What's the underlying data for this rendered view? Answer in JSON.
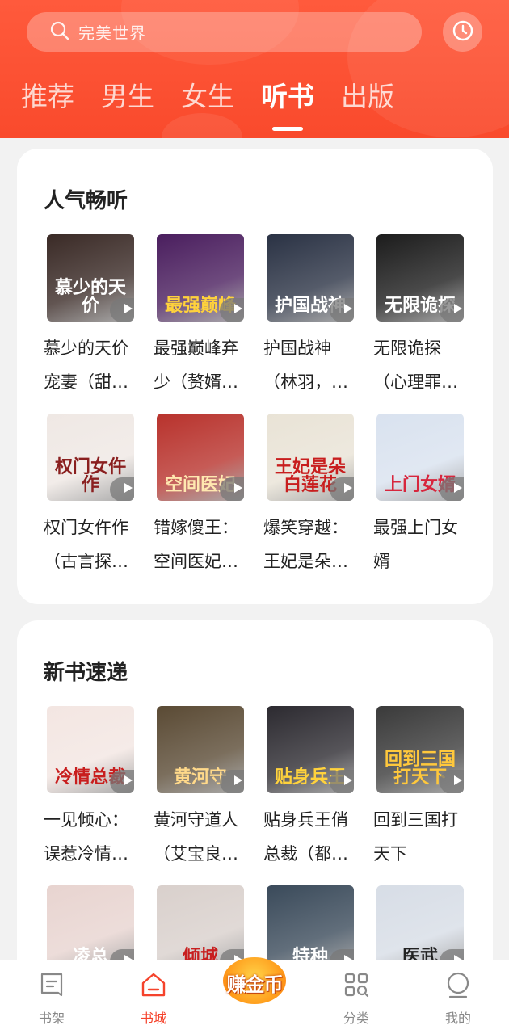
{
  "search": {
    "placeholder": "完美世界"
  },
  "tabs": [
    {
      "label": "推荐",
      "active": false
    },
    {
      "label": "男生",
      "active": false
    },
    {
      "label": "女生",
      "active": false
    },
    {
      "label": "听书",
      "active": true
    },
    {
      "label": "出版",
      "active": false
    }
  ],
  "popular": {
    "title": "人气畅听",
    "books": [
      {
        "name": "慕少的天价宠妻（甜…",
        "cover_text": "慕少的天价",
        "bg": "#3a2a26",
        "fg": "#ffffff"
      },
      {
        "name": "最强巅峰弃少（赘婿…",
        "cover_text": "最强巅峰",
        "bg": "#4a1e5e",
        "fg": "#ffd23c"
      },
      {
        "name": "护国战神（林羽，…",
        "cover_text": "护国战神",
        "bg": "#2a3244",
        "fg": "#ffffff"
      },
      {
        "name": "无限诡探（心理罪…",
        "cover_text": "无限诡探",
        "bg": "#1c1c1c",
        "fg": "#ffffff"
      },
      {
        "name": "权门女仵作（古言探…",
        "cover_text": "权门女仵作",
        "bg": "#efe8e4",
        "fg": "#8a1f1f"
      },
      {
        "name": "错嫁傻王：空间医妃…",
        "cover_text": "空间医妃",
        "bg": "#b8322c",
        "fg": "#ffe8b0"
      },
      {
        "name": "爆笑穿越：王妃是朵…",
        "cover_text": "王妃是朵白莲花",
        "bg": "#e9e3d6",
        "fg": "#c81e1e"
      },
      {
        "name": "最强上门女婿",
        "cover_text": "上门女婿",
        "bg": "#d9e2ef",
        "fg": "#d7263d"
      }
    ]
  },
  "new_books": {
    "title": "新书速递",
    "books": [
      {
        "name": "一见倾心：误惹冷情…",
        "cover_text": "冷情总裁",
        "bg": "#f3e6e2",
        "fg": "#c81e1e"
      },
      {
        "name": "黄河守道人（艾宝良…",
        "cover_text": "黄河守",
        "bg": "#5a4a34",
        "fg": "#ffd98a"
      },
      {
        "name": "贴身兵王俏总裁（都…",
        "cover_text": "贴身兵王",
        "bg": "#2c2a30",
        "fg": "#ffd23c"
      },
      {
        "name": "回到三国打天下",
        "cover_text": "回到三国打天下",
        "bg": "#3a3a3a",
        "fg": "#ffc83c"
      },
      {
        "name": "",
        "cover_text": "凌总",
        "bg": "#e8d4d0",
        "fg": "#ffffff"
      },
      {
        "name": "",
        "cover_text": "倾城",
        "bg": "#d9d0cc",
        "fg": "#c81e1e"
      },
      {
        "name": "",
        "cover_text": "特种",
        "bg": "#3a4a5a",
        "fg": "#ffffff"
      },
      {
        "name": "",
        "cover_text": "医武",
        "bg": "#d7dde6",
        "fg": "#222222"
      }
    ]
  },
  "bottom_nav": [
    {
      "label": "书架",
      "icon": "bookshelf-icon",
      "active": false
    },
    {
      "label": "书城",
      "icon": "bookstore-icon",
      "active": true
    },
    {
      "label": "赚金币",
      "icon": "gold-coin-icon",
      "active": false
    },
    {
      "label": "分类",
      "icon": "category-icon",
      "active": false
    },
    {
      "label": "我的",
      "icon": "profile-icon",
      "active": false
    }
  ],
  "colors": {
    "accent": "#f94a2c",
    "active_nav": "#f5432c"
  }
}
